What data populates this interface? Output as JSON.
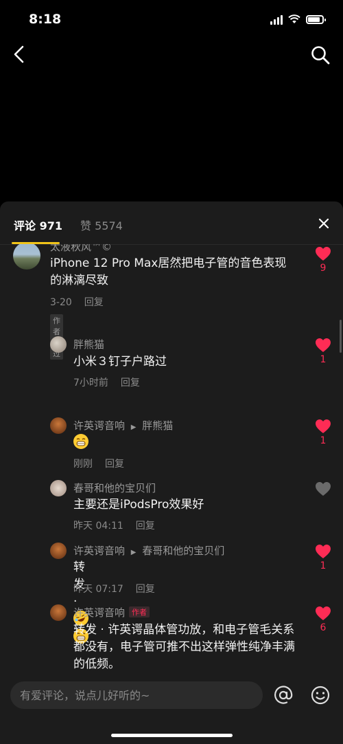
{
  "status_bar": {
    "time": "8:18",
    "battery_level": 0.85
  },
  "tabs": {
    "comments_label": "评论 971",
    "likes_label": "赞 5574"
  },
  "comments": [
    {
      "user": "太液秋风™©",
      "text": "iPhone 12 Pro Max居然把电子管的音色表现的淋漓尽致",
      "date": "3-20",
      "reply": "回复",
      "badge": "作者赞过",
      "likes": "9",
      "liked": true
    },
    {
      "user": "胖熊猫",
      "text": "小米３钉子户路过",
      "date": "7小时前",
      "reply": "回复",
      "likes": "1",
      "liked": true
    },
    {
      "user": "许英谔音响",
      "reply_to": "胖熊猫",
      "date": "刚刚",
      "reply": "回复",
      "likes": "1",
      "liked": true
    },
    {
      "user": "春哥和他的宝贝们",
      "text": "主要还是iPodsPro效果好",
      "date": "昨天 04:11",
      "reply": "回复",
      "likes": "",
      "liked": false
    },
    {
      "user": "许英谔音响",
      "reply_to": "春哥和他的宝贝们",
      "text": "转发 · ",
      "date": "昨天 07:17",
      "reply": "回复",
      "likes": "1",
      "liked": true
    },
    {
      "user": "许英谔音响",
      "author_badge": "作者",
      "text": "转发 · 许英谔晶体管功放，和电子管毛关系都没有，电子管可推不出这样弹性纯净丰满的低频。",
      "likes": "6",
      "liked": true
    }
  ],
  "input": {
    "placeholder": "有爱评论，说点儿好听的~"
  },
  "colors": {
    "accent": "#fe2c55",
    "tab_indicator": "#f0c419",
    "sheet_bg": "#1c1c1c"
  },
  "icons": [
    "back-arrow-icon",
    "search-icon",
    "close-icon",
    "heart-icon",
    "at-icon",
    "emoji-icon"
  ]
}
